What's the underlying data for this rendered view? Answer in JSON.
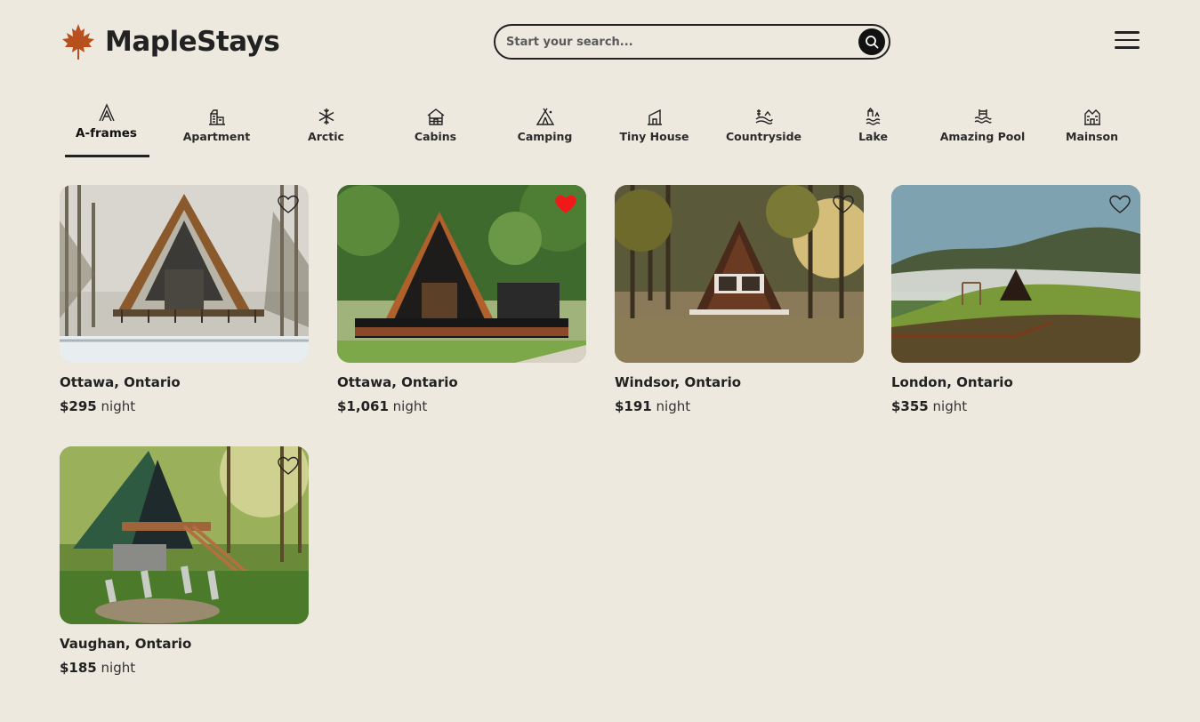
{
  "brand": {
    "name": "MapleStays",
    "accent": "#b8501e"
  },
  "search": {
    "placeholder": "Start your search..."
  },
  "header": {
    "menu_icon": "hamburger-icon",
    "search_icon": "search-icon"
  },
  "categories": [
    {
      "label": "A-frames",
      "icon": "a-frame-icon",
      "active": true
    },
    {
      "label": "Apartment",
      "icon": "apartment-icon",
      "active": false
    },
    {
      "label": "Arctic",
      "icon": "snowflake-icon",
      "active": false
    },
    {
      "label": "Cabins",
      "icon": "cabin-icon",
      "active": false
    },
    {
      "label": "Camping",
      "icon": "tent-icon",
      "active": false
    },
    {
      "label": "Tiny House",
      "icon": "tiny-house-icon",
      "active": false
    },
    {
      "label": "Countryside",
      "icon": "countryside-icon",
      "active": false
    },
    {
      "label": "Lake",
      "icon": "lake-icon",
      "active": false
    },
    {
      "label": "Amazing Pool",
      "icon": "pool-icon",
      "active": false
    },
    {
      "label": "Mainson",
      "icon": "mansion-icon",
      "active": false
    }
  ],
  "listings": [
    {
      "location": "Ottawa, Ontario",
      "price": "$295",
      "unit": "night",
      "favorited": false,
      "photo": "a-frame-cabin-winter-forest"
    },
    {
      "location": "Ottawa, Ontario",
      "price": "$1,061",
      "unit": "night",
      "favorited": true,
      "photo": "black-a-frame-with-deck"
    },
    {
      "location": "Windsor, Ontario",
      "price": "$191",
      "unit": "night",
      "favorited": false,
      "photo": "a-frame-in-autumn-woods"
    },
    {
      "location": "London, Ontario",
      "price": "$355",
      "unit": "night",
      "favorited": false,
      "photo": "a-frame-on-hill-valley"
    },
    {
      "location": "Vaughan, Ontario",
      "price": "$185",
      "unit": "night",
      "favorited": false,
      "photo": "green-roof-a-frame-with-chairs"
    }
  ],
  "colors": {
    "background": "#ede9df",
    "heart_active": "#f01818",
    "text": "#222222"
  }
}
